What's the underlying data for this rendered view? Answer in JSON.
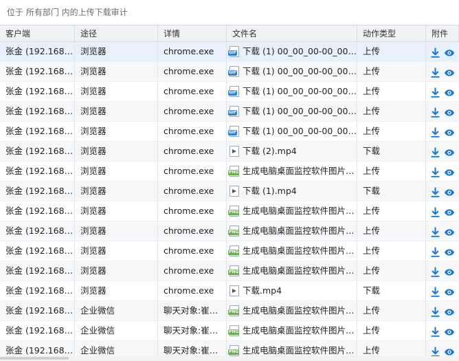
{
  "location": "位于 所有部门 内的上传下载审计",
  "columns": [
    "客户端",
    "途径",
    "详情",
    "文件名",
    "动作类型",
    "附件"
  ],
  "rows": [
    {
      "client": "张金 (192.168.3...",
      "channel": "浏览器",
      "detail": "chrome.exe",
      "icon": "gif",
      "file": "下载 (1) 00_00_00-00_00_0...",
      "action": "上传"
    },
    {
      "client": "张金 (192.168.3...",
      "channel": "浏览器",
      "detail": "chrome.exe",
      "icon": "gif",
      "file": "下载 (1) 00_00_00-00_00_0...",
      "action": "上传"
    },
    {
      "client": "张金 (192.168.3...",
      "channel": "浏览器",
      "detail": "chrome.exe",
      "icon": "gif",
      "file": "下载 (1) 00_00_00-00_00_0...",
      "action": "上传"
    },
    {
      "client": "张金 (192.168.3...",
      "channel": "浏览器",
      "detail": "chrome.exe",
      "icon": "gif",
      "file": "下载 (1) 00_00_00-00_00_0...",
      "action": "上传"
    },
    {
      "client": "张金 (192.168.3...",
      "channel": "浏览器",
      "detail": "chrome.exe",
      "icon": "gif",
      "file": "下载 (1) 00_00_00-00_00_0...",
      "action": "上传"
    },
    {
      "client": "张金 (192.168.3...",
      "channel": "浏览器",
      "detail": "chrome.exe",
      "icon": "mp4",
      "file": "下载 (2).mp4",
      "action": "下载"
    },
    {
      "client": "张金 (192.168.3...",
      "channel": "浏览器",
      "detail": "chrome.exe",
      "icon": "png",
      "file": "生成电脑桌面监控软件图片 (...",
      "action": "上传"
    },
    {
      "client": "张金 (192.168.3...",
      "channel": "浏览器",
      "detail": "chrome.exe",
      "icon": "mp4",
      "file": "下载 (1).mp4",
      "action": "下载"
    },
    {
      "client": "张金 (192.168.3...",
      "channel": "浏览器",
      "detail": "chrome.exe",
      "icon": "png",
      "file": "生成电脑桌面监控软件图片 (...",
      "action": "上传"
    },
    {
      "client": "张金 (192.168.3...",
      "channel": "浏览器",
      "detail": "chrome.exe",
      "icon": "png",
      "file": "生成电脑桌面监控软件图片 (...",
      "action": "上传"
    },
    {
      "client": "张金 (192.168.3...",
      "channel": "浏览器",
      "detail": "chrome.exe",
      "icon": "png",
      "file": "生成电脑桌面监控软件图片 (...",
      "action": "上传"
    },
    {
      "client": "张金 (192.168.3...",
      "channel": "浏览器",
      "detail": "chrome.exe",
      "icon": "png",
      "file": "生成电脑桌面监控软件图片 (...",
      "action": "上传"
    },
    {
      "client": "张金 (192.168.3...",
      "channel": "浏览器",
      "detail": "chrome.exe",
      "icon": "mp4",
      "file": "下载.mp4",
      "action": "下载"
    },
    {
      "client": "张金 (192.168.3...",
      "channel": "企业微信",
      "detail": "聊天对象:崔丽...",
      "icon": "png",
      "file": "生成电脑桌面监控软件图片 (...",
      "action": "上传"
    },
    {
      "client": "张金 (192.168.3...",
      "channel": "企业微信",
      "detail": "聊天对象:崔丽...",
      "icon": "png",
      "file": "生成电脑桌面监控软件图片 (...",
      "action": "上传"
    },
    {
      "client": "张金 (192.168.3...",
      "channel": "企业微信",
      "detail": "聊天对象:崔丽...",
      "icon": "png",
      "file": "生成电脑桌面监控软件图片 (...",
      "action": "上传"
    }
  ],
  "icon_tags": {
    "gif": "GIF",
    "png": "PNG",
    "mp4": ""
  },
  "colors": {
    "accent": "#1a78d0",
    "header_bg": "#f0f2f5",
    "selected_row": "#e8f1fb"
  }
}
